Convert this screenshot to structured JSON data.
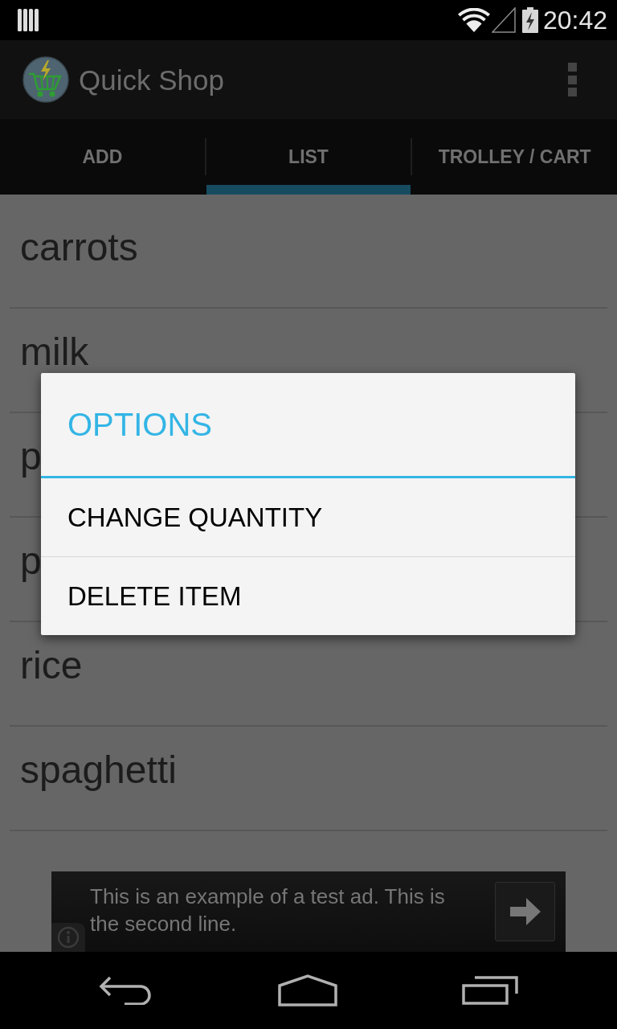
{
  "status_bar": {
    "time": "20:42"
  },
  "action_bar": {
    "title": "Quick Shop"
  },
  "tabs": [
    {
      "label": "ADD",
      "selected": false
    },
    {
      "label": "LIST",
      "selected": true
    },
    {
      "label": "TROLLEY / CART",
      "selected": false
    }
  ],
  "list": {
    "items": [
      "carrots",
      "milk",
      "p",
      "p",
      "rice",
      "spaghetti"
    ]
  },
  "dialog": {
    "title": "OPTIONS",
    "items": [
      "CHANGE QUANTITY",
      "DELETE ITEM"
    ]
  },
  "ad_banner": {
    "text": "This is an example of a test ad. This is the second line."
  }
}
